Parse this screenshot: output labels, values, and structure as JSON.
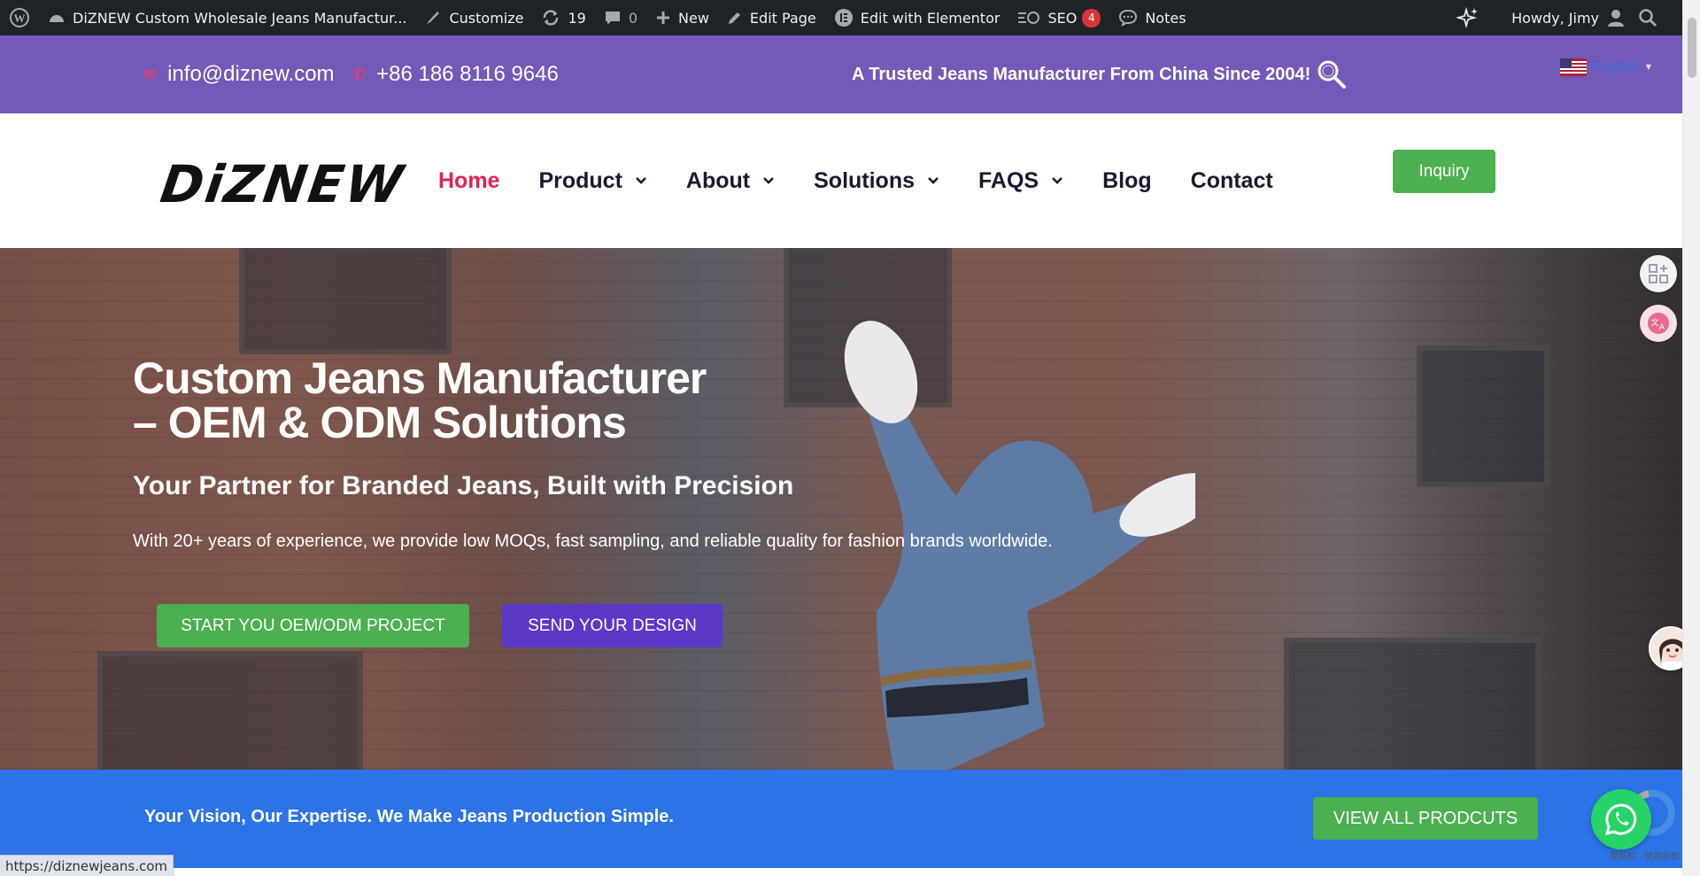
{
  "adminbar": {
    "site_title": "DiZNEW Custom Wholesale Jeans Manufactur...",
    "customize": "Customize",
    "updates": "19",
    "comments": "0",
    "new": "New",
    "edit_page": "Edit Page",
    "edit_elementor": "Edit with Elementor",
    "seo": "SEO",
    "seo_badge": "4",
    "notes": "Notes",
    "howdy": "Howdy, Jimy"
  },
  "topbar": {
    "email": "info@diznew.com",
    "phone": "+86 186 8116 9646",
    "tagline": "A Trusted Jeans Manufacturer From China Since 2004!",
    "language": "English",
    "accent": "#7359b8"
  },
  "header": {
    "logo": "DiZNEW",
    "nav": [
      {
        "label": "Home",
        "dropdown": false
      },
      {
        "label": "Product",
        "dropdown": true
      },
      {
        "label": "About",
        "dropdown": true
      },
      {
        "label": "Solutions",
        "dropdown": true
      },
      {
        "label": "FAQS",
        "dropdown": true
      },
      {
        "label": "Blog",
        "dropdown": false
      },
      {
        "label": "Contact",
        "dropdown": false
      }
    ],
    "inquiry": "Inquiry"
  },
  "hero": {
    "title_line1": "Custom Jeans Manufacturer",
    "title_line2": "– OEM & ODM Solutions",
    "subtitle": "Your Partner for Branded Jeans, Built with Precision",
    "description": "With 20+ years of experience, we provide low MOQs, fast sampling, and reliable quality for fashion brands worldwide.",
    "cta_primary": "START YOU OEM/ODM PROJECT",
    "cta_secondary": "SEND YOUR DESIGN"
  },
  "band": {
    "text": "Your Vision, Our Expertise. We Make Jeans Production Simple.",
    "button": "VIEW ALL PRODCUTS",
    "color": "#2b73e6"
  },
  "recaptcha": {
    "text": "隐私权 - 使用条款"
  },
  "status": {
    "url": "https://diznewjeans.com"
  }
}
